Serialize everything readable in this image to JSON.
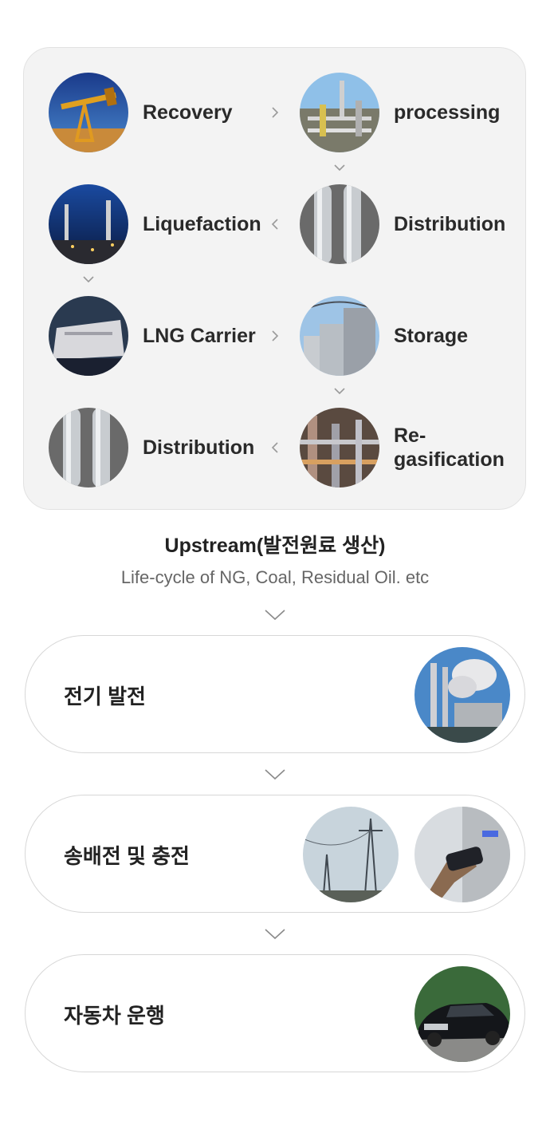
{
  "upstream_cycle": {
    "nodes": [
      {
        "label": "Recovery",
        "icon": "oil-pump-photo"
      },
      {
        "label": "processing",
        "icon": "processing-plant-photo"
      },
      {
        "label": "Distribution",
        "icon": "pipeline-photo"
      },
      {
        "label": "Liquefaction",
        "icon": "liquefaction-plant-photo"
      },
      {
        "label": "LNG Carrier",
        "icon": "lng-ship-photo"
      },
      {
        "label": "Storage",
        "icon": "storage-tank-photo"
      },
      {
        "label": "Re-\ngasification",
        "icon": "regasification-plant-photo"
      },
      {
        "label": "Distribution",
        "icon": "pipeline-photo"
      }
    ]
  },
  "caption": {
    "title": "Upstream(발전원료 생산)",
    "subtitle": "Life-cycle of NG, Coal, Residual Oil. etc"
  },
  "stages": [
    {
      "label": "전기 발전",
      "icons": [
        "power-plant-photo"
      ]
    },
    {
      "label": "송배전 및 충전",
      "icons": [
        "transmission-tower-photo",
        "ev-charger-photo"
      ]
    },
    {
      "label": "자동차 운행",
      "icons": [
        "car-photo"
      ]
    }
  ],
  "colors": {
    "panel_bg": "#f3f3f3",
    "arrow": "#9a9a9a",
    "text": "#222222",
    "sub_text": "#666666"
  }
}
